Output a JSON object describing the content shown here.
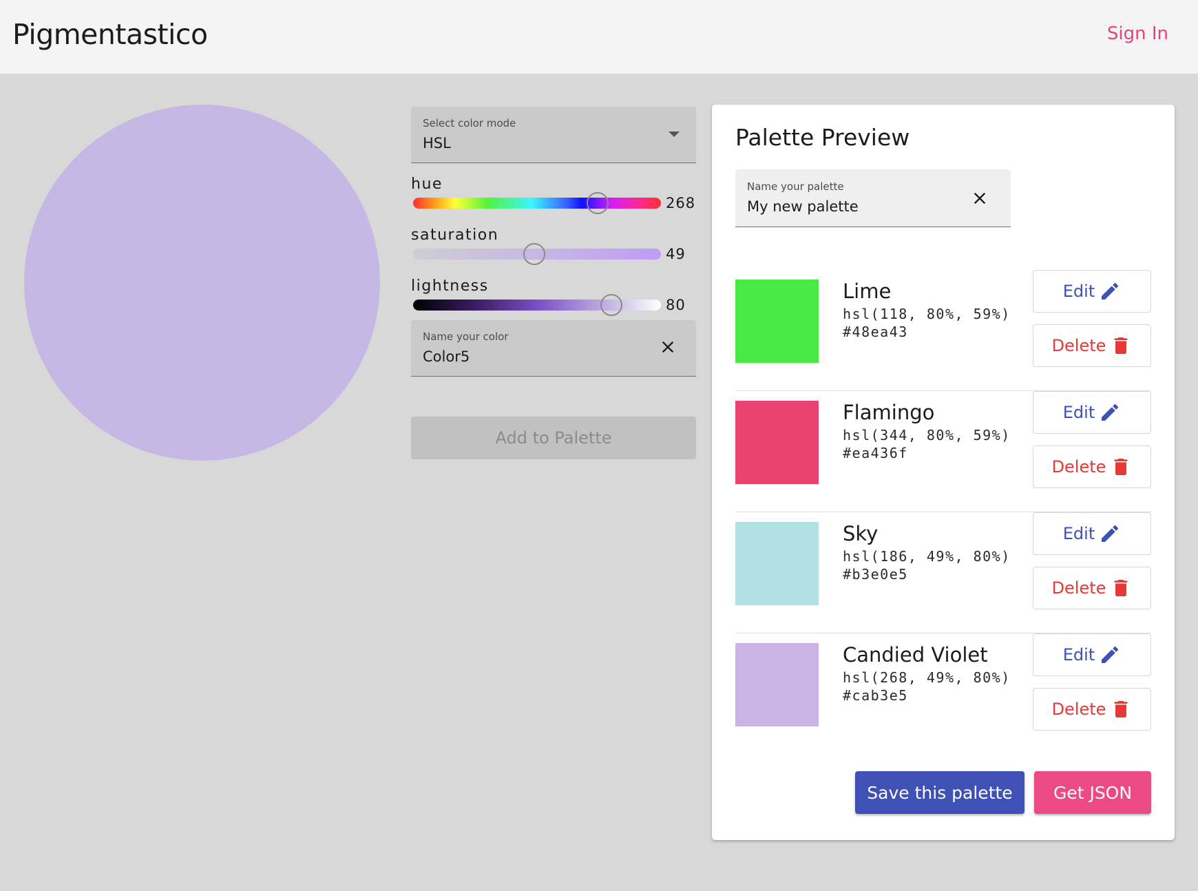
{
  "app": {
    "title": "Pigmentastico",
    "sign_in": "Sign In"
  },
  "preview": {
    "color": "#c7b7e4"
  },
  "controls": {
    "mode": {
      "label": "Select color mode",
      "value": "HSL"
    },
    "hue": {
      "label": "hue",
      "value": 268,
      "max": 360
    },
    "saturation": {
      "label": "saturation",
      "value": 49,
      "max": 100
    },
    "lightness": {
      "label": "lightness",
      "value": 80,
      "max": 100
    },
    "color_name": {
      "label": "Name your color",
      "value": "Color5"
    },
    "add_button": "Add to Palette"
  },
  "palette": {
    "title": "Palette Preview",
    "name_field": {
      "label": "Name your palette",
      "value": "My new palette"
    },
    "edit_label": "Edit",
    "delete_label": "Delete",
    "colors": [
      {
        "name": "Lime",
        "hsl": "hsl(118, 80%, 59%)",
        "hex": "#48ea43"
      },
      {
        "name": "Flamingo",
        "hsl": "hsl(344, 80%, 59%)",
        "hex": "#ea436f"
      },
      {
        "name": "Sky",
        "hsl": "hsl(186, 49%, 80%)",
        "hex": "#b3e0e5"
      },
      {
        "name": "Candied Violet",
        "hsl": "hsl(268, 49%, 80%)",
        "hex": "#cab3e5"
      }
    ],
    "save_button": "Save this palette",
    "json_button": "Get JSON"
  },
  "colors": {
    "accent_blue": "#3f51b5",
    "accent_pink": "#ec4a82",
    "delete_red": "#e53935"
  },
  "icons": [
    "dropdown-caret-icon",
    "close-icon",
    "pencil-icon",
    "trash-icon"
  ]
}
